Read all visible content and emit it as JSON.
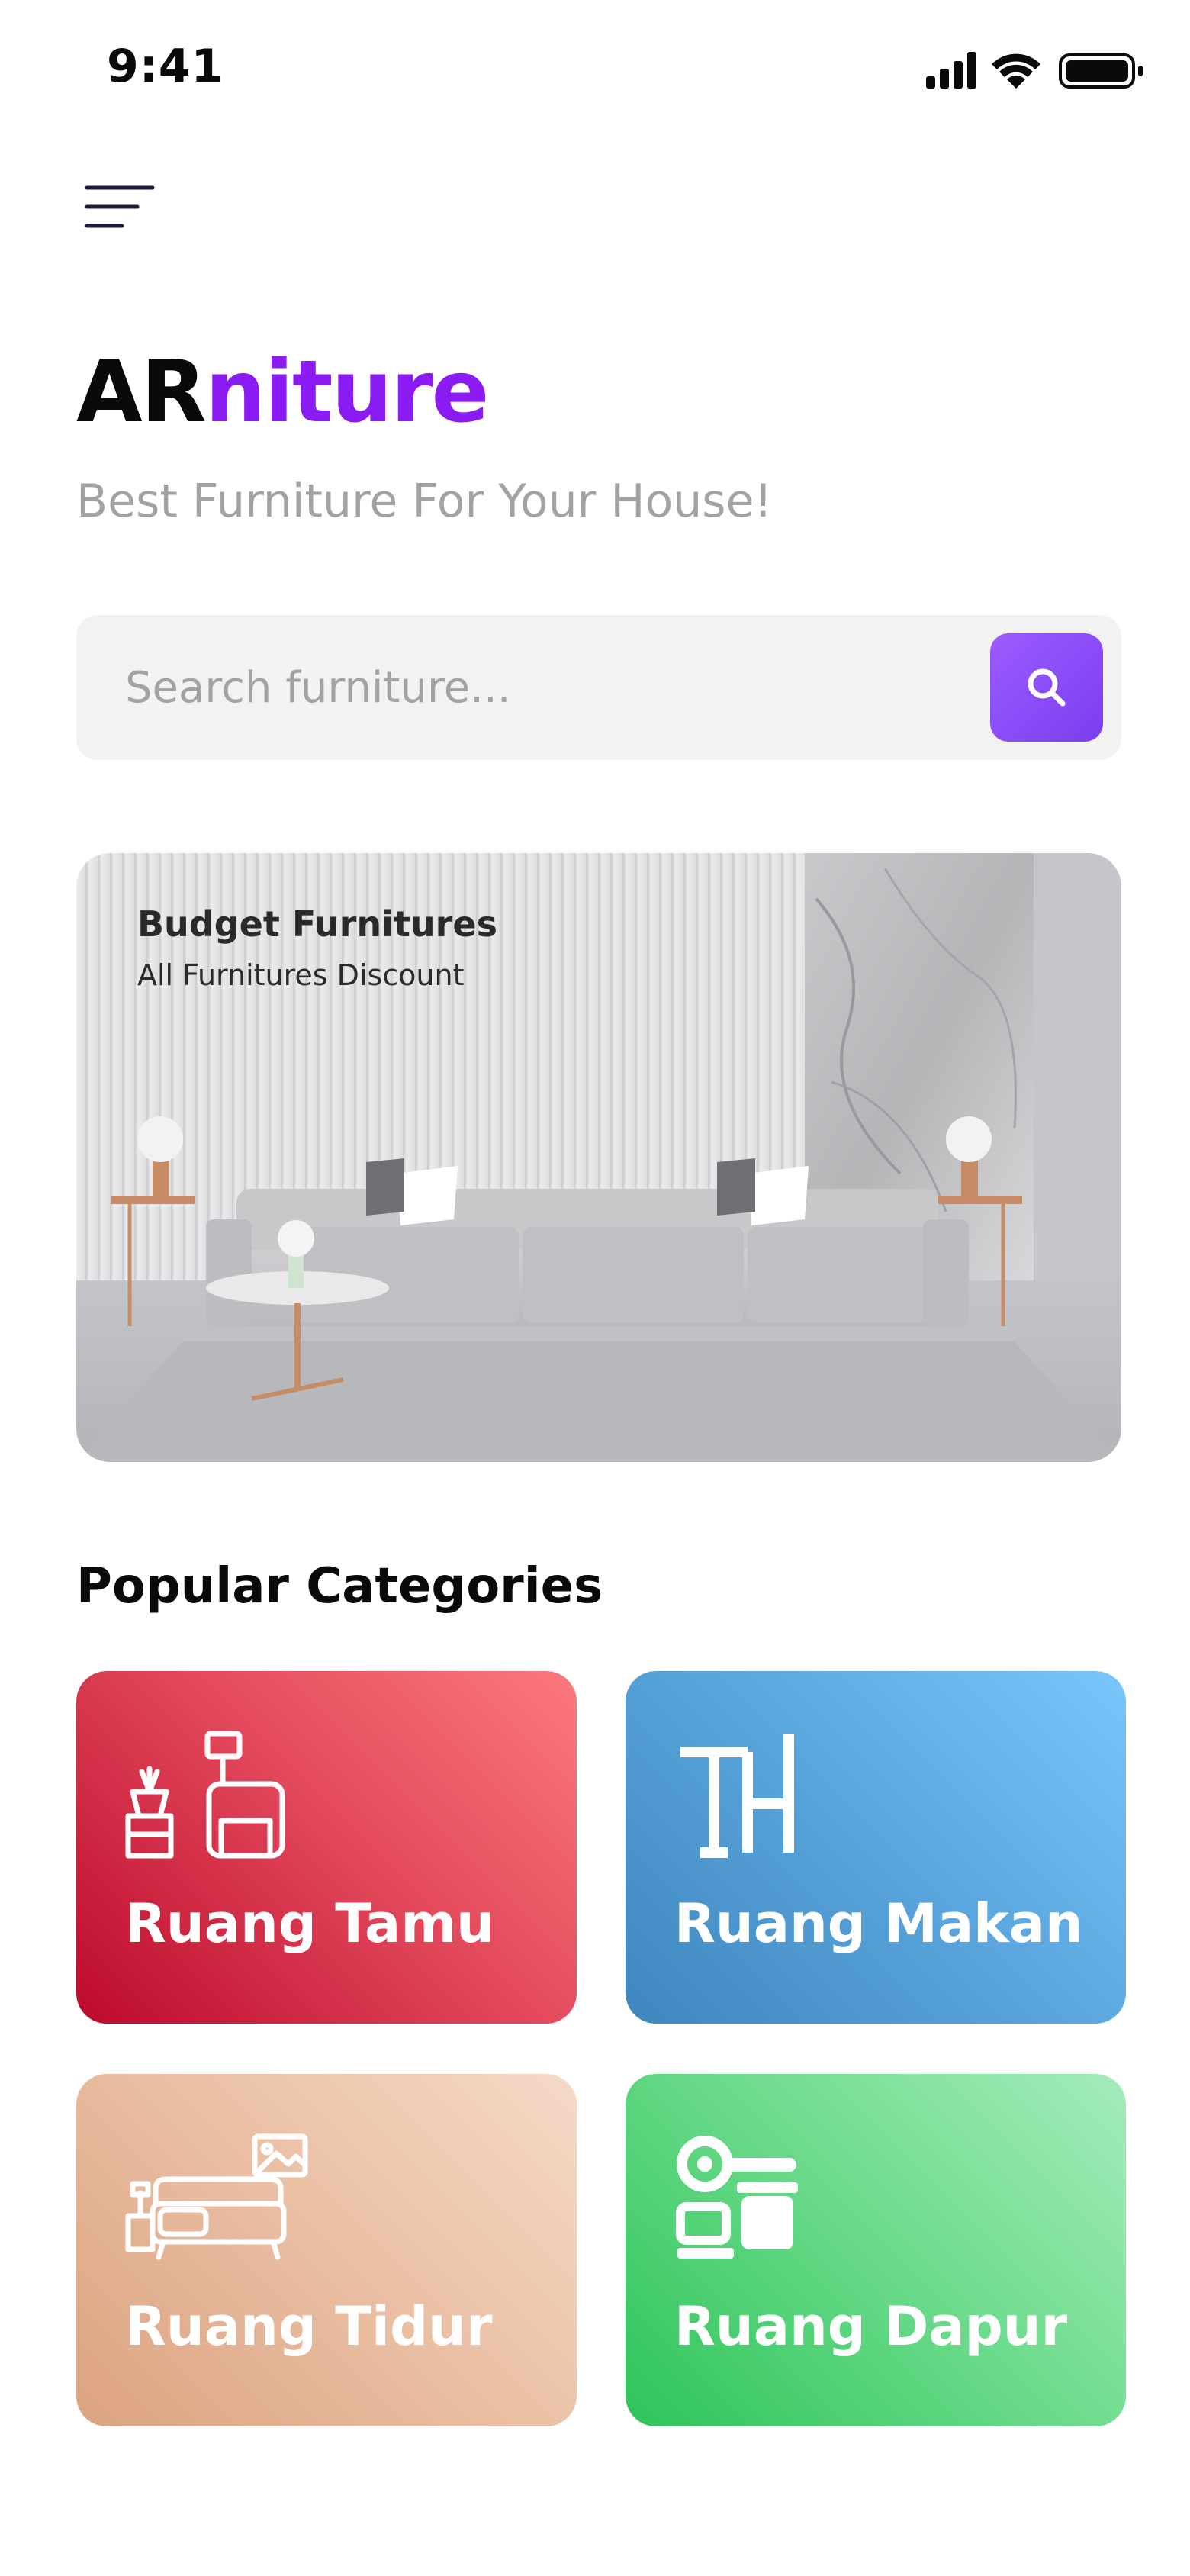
{
  "status_bar": {
    "time": "9:41"
  },
  "header": {
    "brand_part1": "AR",
    "brand_part2": "niture",
    "tagline": "Best Furniture For Your House!"
  },
  "search": {
    "placeholder": "Search furniture...",
    "value": ""
  },
  "banner": {
    "title": "Budget Furnitures",
    "subtitle": "All Furnitures Discount"
  },
  "categories": {
    "title": "Popular Categories",
    "items": [
      {
        "label": "Ruang Tamu",
        "icon": "living-room-icon"
      },
      {
        "label": "Ruang Makan",
        "icon": "dining-table-icon"
      },
      {
        "label": "Ruang Tidur",
        "icon": "bedroom-icon"
      },
      {
        "label": "Ruang Dapur",
        "icon": "kitchen-icon"
      }
    ]
  },
  "colors": {
    "brand_accent": "#8a1bf2",
    "search_button": "#8b4cf8",
    "card_red": "#e34a5c",
    "card_blue": "#5ca7df",
    "card_peach": "#ebc1a6",
    "card_green": "#6fdc8e"
  }
}
